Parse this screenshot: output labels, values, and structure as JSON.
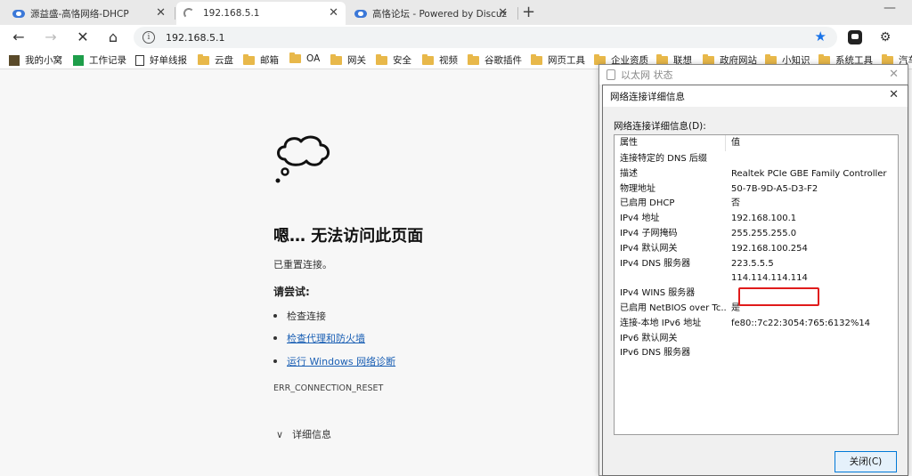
{
  "tabs": [
    {
      "title": "源益盛-高恪网络-DHCP",
      "close": "✕"
    },
    {
      "title": "192.168.5.1",
      "close": "✕"
    },
    {
      "title": "高恪论坛 - Powered by Discuz!",
      "close": "✕"
    }
  ],
  "tabstrip": {
    "new_tab": "+",
    "minimize": "—"
  },
  "navbar": {
    "back": "←",
    "forward": "→",
    "stop": "✕",
    "home": "⌂",
    "url": "192.168.5.1",
    "info": "i",
    "star": "★",
    "extension_icon": "⚙"
  },
  "bookmarks": [
    "我的小窝",
    "工作记录",
    "好单线报",
    "云盘",
    "邮箱",
    "OA",
    "网关",
    "安全",
    "视频",
    "谷歌插件",
    "网页工具",
    "企业资质",
    "联想",
    "政府网站",
    "小知识",
    "系统工具",
    "汽车"
  ],
  "error_page": {
    "title": "嗯… 无法访问此页面",
    "subtitle": "已重置连接。",
    "try_heading": "请尝试:",
    "suggestions": [
      "检查连接",
      "检查代理和防火墙",
      "运行 Windows 网络诊断"
    ],
    "error_code": "ERR_CONNECTION_RESET",
    "details": "详细信息",
    "details_chevron": "∨"
  },
  "status_window": {
    "title": "以太网 状态",
    "close": "✕"
  },
  "dialog": {
    "title": "网络连接详细信息",
    "close": "✕",
    "label": "网络连接详细信息(D):",
    "columns": [
      "属性",
      "值"
    ],
    "rows": [
      [
        "连接特定的 DNS 后缀",
        ""
      ],
      [
        "描述",
        "Realtek PCIe GBE Family Controller"
      ],
      [
        "物理地址",
        "50-7B-9D-A5-D3-F2"
      ],
      [
        "已启用 DHCP",
        "否"
      ],
      [
        "IPv4 地址",
        "192.168.100.1"
      ],
      [
        "IPv4 子网掩码",
        "255.255.255.0"
      ],
      [
        "IPv4 默认网关",
        "192.168.100.254"
      ],
      [
        "IPv4 DNS 服务器",
        "223.5.5.5"
      ],
      [
        "",
        "114.114.114.114"
      ],
      [
        "IPv4 WINS 服务器",
        ""
      ],
      [
        "已启用 NetBIOS over Tc...",
        "是"
      ],
      [
        "连接-本地 IPv6 地址",
        "fe80::7c22:3054:765:6132%14"
      ],
      [
        "IPv6 默认网关",
        ""
      ],
      [
        "IPv6 DNS 服务器",
        ""
      ]
    ],
    "close_button": "关闭(C)"
  },
  "colors": {
    "accent": "#1a73e8",
    "highlight": "#e01b1b",
    "folder": "#e8b84a"
  }
}
